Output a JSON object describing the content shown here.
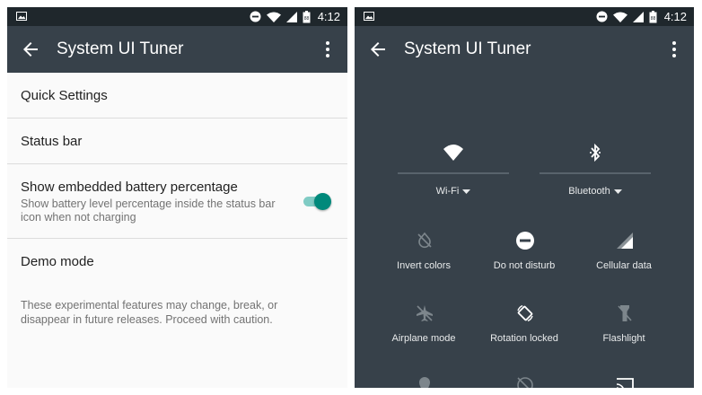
{
  "left_screen": {
    "status_bar": {
      "time": "4:12"
    },
    "app_bar": {
      "title": "System UI Tuner"
    },
    "items": [
      {
        "title": "Quick Settings"
      },
      {
        "title": "Status bar"
      },
      {
        "title": "Show embedded battery percentage",
        "subtitle": "Show battery level percentage inside the status bar icon when not charging",
        "toggle_on": true
      },
      {
        "title": "Demo mode"
      }
    ],
    "footer_note": "These experimental features may change, break, or disappear in future releases. Proceed with caution."
  },
  "right_screen": {
    "status_bar": {
      "time": "4:12"
    },
    "app_bar": {
      "title": "System UI Tuner"
    },
    "big_tiles": [
      {
        "label": "Wi-Fi",
        "icon": "wifi-icon"
      },
      {
        "label": "Bluetooth",
        "icon": "bluetooth-icon"
      }
    ],
    "tiles": [
      {
        "label": "Invert colors",
        "icon": "invert-colors-icon"
      },
      {
        "label": "Do not disturb",
        "icon": "do-not-disturb-icon"
      },
      {
        "label": "Cellular data",
        "icon": "cellular-data-icon"
      },
      {
        "label": "Airplane mode",
        "icon": "airplane-mode-icon"
      },
      {
        "label": "Rotation locked",
        "icon": "rotation-locked-icon"
      },
      {
        "label": "Flashlight",
        "icon": "flashlight-icon"
      }
    ]
  },
  "colors": {
    "app_bar": "#37414a",
    "status_bar": "#1f272c",
    "accent": "#00897b"
  }
}
